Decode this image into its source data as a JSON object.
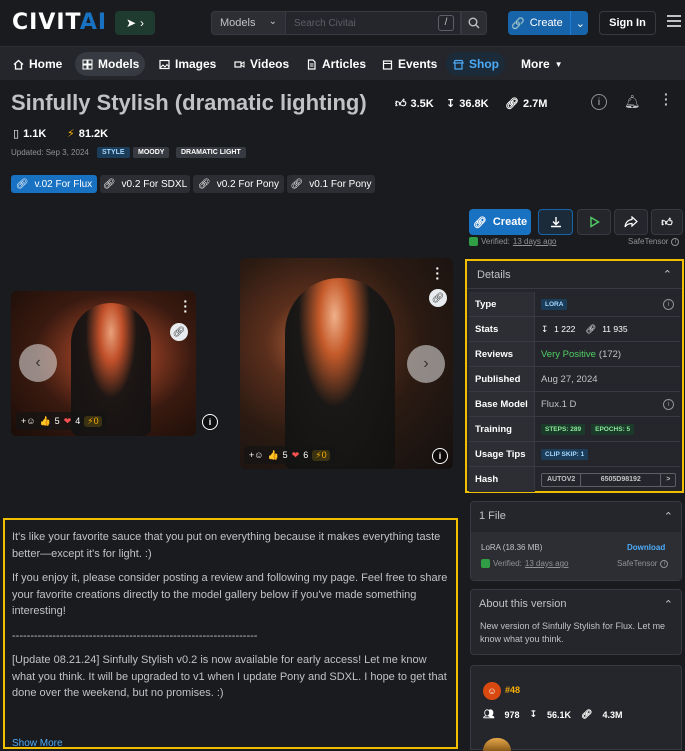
{
  "header": {
    "logo_main": "CIVIT",
    "logo_accent": "AI",
    "search_category": "Models",
    "search_placeholder": "Search Civitai",
    "search_shortcut": "/",
    "create_label": "Create",
    "signin_label": "Sign In"
  },
  "nav": [
    {
      "label": "Home",
      "icon": "home-icon"
    },
    {
      "label": "Models",
      "icon": "grid-icon"
    },
    {
      "label": "Images",
      "icon": "image-icon"
    },
    {
      "label": "Videos",
      "icon": "video-icon"
    },
    {
      "label": "Articles",
      "icon": "document-icon"
    },
    {
      "label": "Events",
      "icon": "calendar-icon"
    },
    {
      "label": "Shop",
      "icon": "shop-icon"
    },
    {
      "label": "More",
      "icon": "caret-down-icon"
    }
  ],
  "model": {
    "title": "Sinfully Stylish (dramatic lighting)",
    "likes": "3.5K",
    "downloads": "36.8K",
    "generations": "2.7M",
    "collected": "1.1K",
    "buzz": "81.2K",
    "updated": "Updated: Sep 3, 2024",
    "tags": [
      "STYLE",
      "MOODY",
      "DRAMATIC LIGHT"
    ]
  },
  "versions": [
    "v.02 For Flux",
    "v0.2 For SDXL",
    "v0.2 For Pony",
    "v0.1 For Pony"
  ],
  "actions": {
    "create_label": "Create",
    "verified_prefix": "Verified:",
    "verified_date": "13 days ago",
    "safetensor": "SafeTensor"
  },
  "images": [
    {
      "likes": "5",
      "hearts": "4",
      "buzz": "0"
    },
    {
      "likes": "5",
      "hearts": "6",
      "buzz": "0"
    }
  ],
  "details": {
    "title": "Details",
    "rows": {
      "type_label": "Type",
      "type_value": "LORA",
      "stats_label": "Stats",
      "stats_downloads": "1 222",
      "stats_generations": "11 935",
      "reviews_label": "Reviews",
      "reviews_value": "Very Positive",
      "reviews_count": "(172)",
      "published_label": "Published",
      "published_value": "Aug 27, 2024",
      "base_label": "Base Model",
      "base_value": "Flux.1 D",
      "training_label": "Training",
      "training_steps": "STEPS: 289",
      "training_epochs": "EPOCHS: 5",
      "usage_label": "Usage Tips",
      "usage_value": "CLIP SKIP: 1",
      "hash_label": "Hash",
      "hash_type": "AUTOV2",
      "hash_value": "6505D98192",
      "hash_next": ">"
    }
  },
  "files": {
    "title": "1 File",
    "file_name": "LoRA (18.36 MB)",
    "download_label": "Download",
    "verified_prefix": "Verified:",
    "verified_date": "13 days ago",
    "safetensor": "SafeTensor"
  },
  "about": {
    "title": "About this version",
    "text": "New version of Sinfully Stylish for Flux. Let me know what you think."
  },
  "creator_stats": {
    "rank": "#48",
    "followers": "978",
    "downloads": "56.1K",
    "generations": "4.3M"
  },
  "description": {
    "p1": "It's like your favorite sauce that you put on everything because it makes everything taste better—except it's for light. :)",
    "p2": "If you enjoy it, please consider posting a review and following my page. Feel free to share your favorite creations directly to the model gallery below if you've made something interesting!",
    "p3": "-------------------------------------------------------------------",
    "p4": "[Update 08.21.24] Sinfully Stylish v0.2 is now available for early access! Let me know what you think. It will be upgraded to v1 when I update Pony and SDXL. I hope to get that done over the weekend, but no promises. :)",
    "show_more": "Show More"
  },
  "colors": {
    "accent": "#1971c2",
    "highlight_border": "#f0c000",
    "positive": "#51cf66",
    "background": "#1a1b1e"
  }
}
